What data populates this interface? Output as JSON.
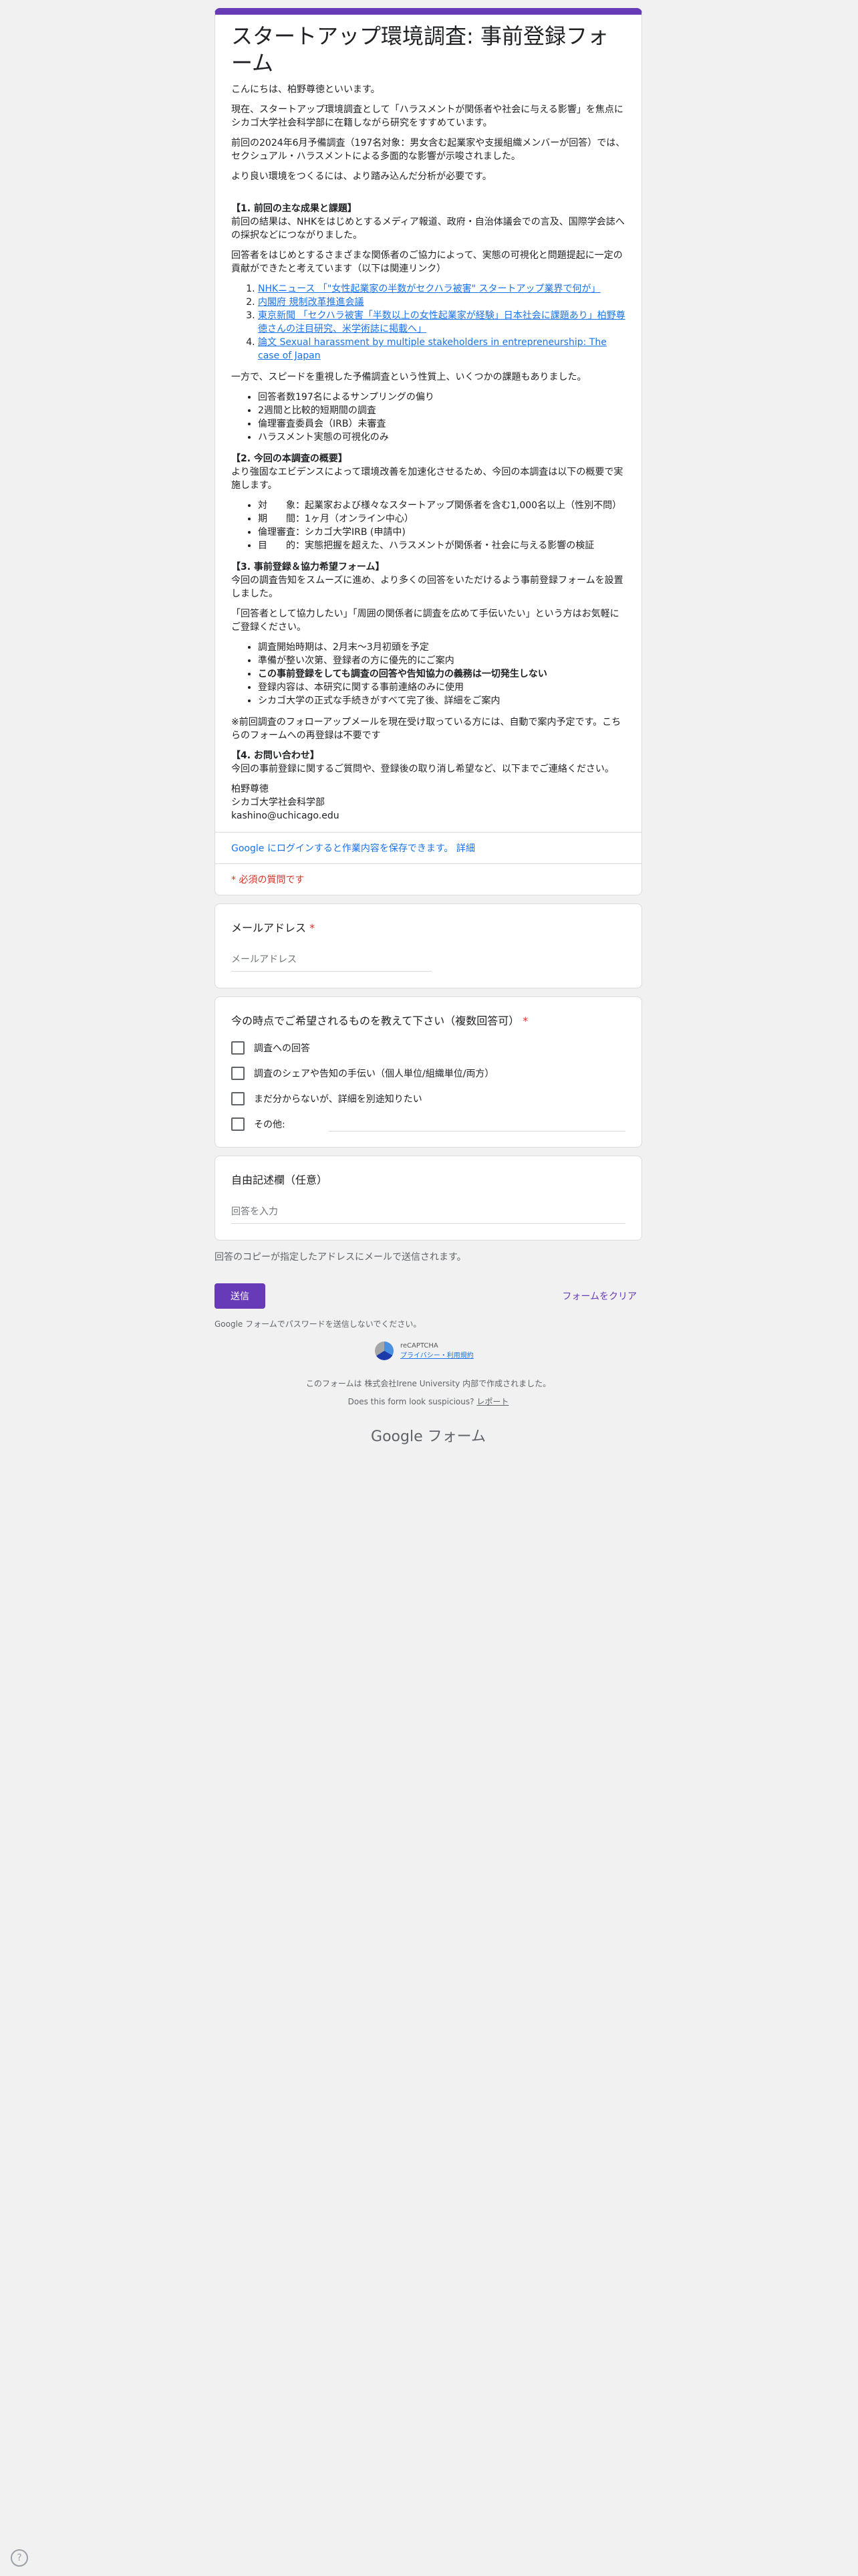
{
  "form": {
    "title": "スタートアップ環境調査: 事前登録フォーム",
    "intro": [
      "こんにちは、柏野尊徳といいます。",
      "現在、スタートアップ環境調査として「ハラスメントが関係者や社会に与える影響」を焦点にシカゴ大学社会科学部に在籍しながら研究をすすめています。",
      "前回の2024年6月予備調査（197名対象：男女含む起業家や支援組織メンバーが回答）では、セクシュアル・ハラスメントによる多面的な影響が示唆されました。",
      "より良い環境をつくるには、より踏み込んだ分析が必要です。"
    ],
    "section1_title": "【1. 前回の主な成果と課題】",
    "section1_text": "前回の結果は、NHKをはじめとするメディア報道、政府・自治体議会での言及、国際学会誌への採択などにつながりました。",
    "section1_text2": "回答者をはじめとするさまざまな関係者のご協力によって、実態の可視化と問題提起に一定の貢献ができたと考えています（以下は関連リンク）",
    "links": [
      "NHKニュース 「\"女性起業家の半数がセクハラ被害\" スタートアップ業界で何が」",
      "内閣府 規制改革推進会議",
      "東京新聞 「セクハラ被害「半数以上の女性起業家が経験」日本社会に課題あり」柏野尊徳さんの注目研究、米学術誌に掲載へ」",
      "論文 Sexual harassment by multiple stakeholders in entrepreneurship: The case of Japan"
    ],
    "section1_text3": "一方で、スピードを重視した予備調査という性質上、いくつかの課題もありました。",
    "issues": [
      "回答者数197名によるサンプリングの偏り",
      "2週間と比較的短期間の調査",
      "倫理審査委員会（IRB）未審査",
      "ハラスメント実態の可視化のみ"
    ],
    "section2_title": "【2. 今回の本調査の概要】",
    "section2_text": "より強固なエビデンスによって環境改善を加速化させるため、今回の本調査は以下の概要で実施します。",
    "overview": [
      "対　　象：起業家および様々なスタートアップ関係者を含む1,000名以上（性別不問）",
      "期　　間：1ヶ月（オンライン中心）",
      "倫理審査：シカゴ大学IRB (申請中)",
      "目　　的：実態把握を超えた、ハラスメントが関係者・社会に与える影響の検証"
    ],
    "section3_title": "【3. 事前登録＆協力希望フォーム】",
    "section3_text": "今回の調査告知をスムーズに進め、より多くの回答をいただけるよう事前登録フォームを設置しました。",
    "section3_text2": "「回答者として協力したい」「周囲の関係者に調査を広めて手伝いたい」という方はお気軽にご登録ください。",
    "notes": [
      "調査開始時期は、2月末〜3月初頭を予定",
      "準備が整い次第、登録者の方に優先的にご案内",
      "この事前登録をしても調査の回答や告知協力の義務は一切発生しない",
      "登録内容は、本研究に関する事前連絡のみに使用",
      "シカゴ大学の正式な手続きがすべて完了後、詳細をご案内"
    ],
    "section3_text3": "※前回調査のフォローアップメールを現在受け取っている方には、自動で案内予定です。こちらのフォームへの再登録は不要です",
    "section4_title": "【4. お問い合わせ】",
    "section4_text": "今回の事前登録に関するご質問や、登録後の取り消し希望など、以下までご連絡ください。",
    "contact": [
      "柏野尊徳",
      "シカゴ大学社会科学部",
      "kashino@uchicago.edu"
    ],
    "login_text": "Google にログインすると作業内容を保存できます。",
    "login_link": "詳細",
    "required_note": "* 必須の質問です"
  },
  "questions": {
    "email_title": "メールアドレス",
    "email_placeholder": "メールアドレス",
    "choice_title": "今の時点でご希望されるものを教えて下さい（複数回答可）",
    "choices": [
      "調査への回答",
      "調査のシェアや告知の手伝い（個人単位/組織単位/両方）",
      "まだ分からないが、詳細を別途知りたい",
      "その他:"
    ],
    "free_title": "自由記述欄（任意）",
    "free_placeholder": "回答を入力"
  },
  "footer": {
    "copy_note": "回答のコピーが指定したアドレスにメールで送信されます。",
    "submit": "送信",
    "clear": "フォームをクリア",
    "password_warning": "Google フォームでパスワードを送信しないでください。",
    "recaptcha": "reCAPTCHA",
    "recaptcha_links": "プライバシー・利用規約",
    "created_by": "このフォームは 株式会社Irene University 内部で作成されました。",
    "suspicious": "Does this form look suspicious?",
    "report": "レポート",
    "brand": "Google フォーム"
  },
  "colors": {
    "accent": "#673ab7",
    "required": "#d93025",
    "link": "#1a73e8"
  }
}
